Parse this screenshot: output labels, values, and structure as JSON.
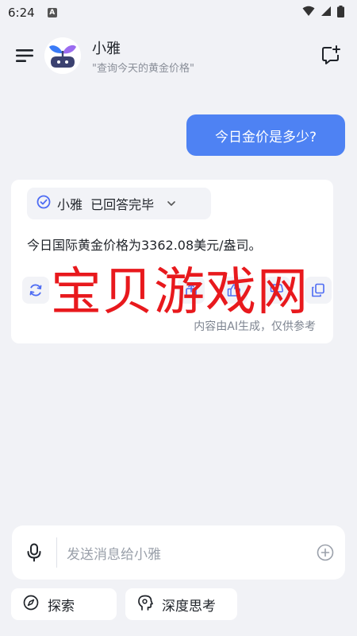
{
  "status_bar": {
    "time": "6:24",
    "badge": "A",
    "icons": [
      "notification-badge-icon",
      "wifi-icon",
      "signal-icon",
      "battery-icon"
    ]
  },
  "header": {
    "title": "小雅",
    "subtitle": "\"查询今天的黄金价格\"",
    "icons": [
      "menu-icon",
      "new-chat-icon"
    ]
  },
  "conversation": {
    "user_message": "今日金价是多少?",
    "assistant": {
      "status": "小雅  已回答完毕",
      "answer": "今日国际黄金价格为3362.08美元/盎司。",
      "disclaimer": "内容由AI生成，仅供参考",
      "actions": [
        "regenerate-icon",
        "share-icon",
        "thumb-up-icon",
        "thumb-down-icon",
        "copy-icon"
      ]
    }
  },
  "watermark": "宝贝游戏网",
  "composer": {
    "placeholder": "发送消息给小雅"
  },
  "chips": [
    {
      "label": "探索",
      "icon": "compass-icon"
    },
    {
      "label": "深度思考",
      "icon": "brain-icon"
    }
  ],
  "colors": {
    "accent": "#4e82f3",
    "background": "#f1f2f6",
    "watermark": "#e8191d"
  }
}
